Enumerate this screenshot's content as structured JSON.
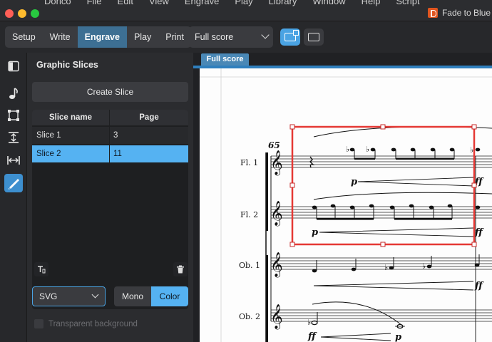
{
  "menu": [
    "Dorico",
    "File",
    "Edit",
    "View",
    "Engrave",
    "Play",
    "Library",
    "Window",
    "Help",
    "Script"
  ],
  "document_title": "Fade to Blue",
  "modes": [
    {
      "label": "Setup",
      "active": false
    },
    {
      "label": "Write",
      "active": false
    },
    {
      "label": "Engrave",
      "active": true
    },
    {
      "label": "Play",
      "active": false
    },
    {
      "label": "Print",
      "active": false
    }
  ],
  "layout_select": "Full score",
  "icons": {
    "left_strip": [
      "panel-toggle-icon",
      "note-icon",
      "frame-icon",
      "spacing-icon",
      "width-icon",
      "graphic-slice-icon"
    ],
    "view_buttons": [
      "page-view-icon",
      "galley-view-icon"
    ]
  },
  "panel": {
    "title": "Graphic Slices",
    "create_button": "Create Slice",
    "columns": [
      "Slice name",
      "Page"
    ],
    "rows": [
      {
        "name": "Slice 1",
        "page": "3",
        "selected": false
      },
      {
        "name": "Slice 2",
        "page": "11",
        "selected": true
      }
    ],
    "format": "SVG",
    "color_modes": [
      "Mono",
      "Color"
    ],
    "active_color_mode": "Color",
    "transparent_label": "Transparent background",
    "transparent_checked": false
  },
  "score": {
    "tab": "Full score",
    "bar_number": "65",
    "instruments": [
      "Fl. 1",
      "Fl. 2",
      "Ob. 1",
      "Ob. 2"
    ],
    "dynamics": {
      "fl1": [
        "p",
        "ff"
      ],
      "fl2": [
        "p",
        "ff"
      ],
      "ob1": [
        "ff"
      ],
      "ob2": [
        "ff",
        "p"
      ]
    }
  },
  "colors": {
    "accent": "#55b2f2",
    "selection_frame": "#e53935",
    "active_mode": "#3d6f93"
  }
}
